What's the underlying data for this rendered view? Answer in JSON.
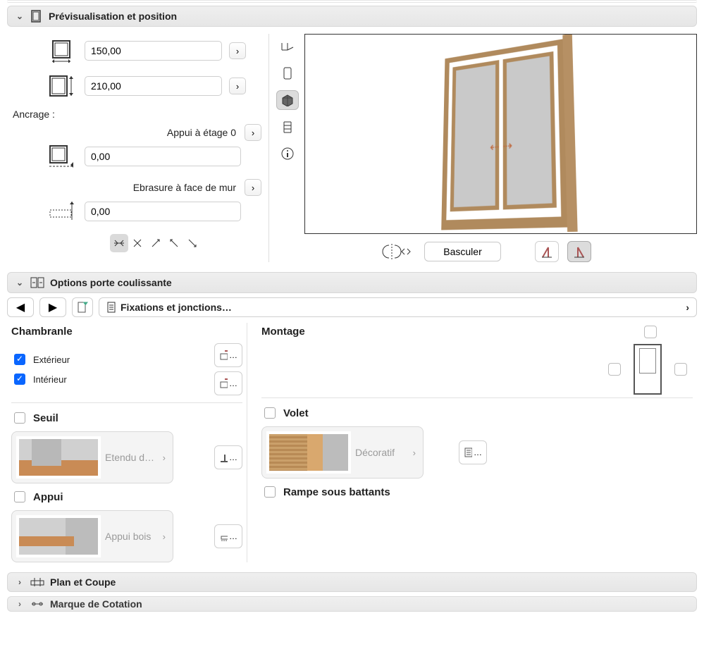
{
  "sections": {
    "preview": {
      "title": "Prévisualisation et position"
    },
    "options": {
      "title": "Options porte coulissante"
    },
    "plan": {
      "title": "Plan et Coupe"
    },
    "quote": {
      "title": "Marque de Cotation"
    }
  },
  "dims": {
    "width": "150,00",
    "height": "210,00"
  },
  "anchor": {
    "label": "Ancrage :",
    "story": {
      "label": "Appui à étage 0",
      "value": "0,00"
    },
    "reveal": {
      "label": "Ebrasure à face de mur",
      "value": "0,00"
    }
  },
  "preview_actions": {
    "flip_label": "Basculer"
  },
  "breadcrumb": {
    "label": "Fixations et jonctions…"
  },
  "chambranle": {
    "title": "Chambranle",
    "ext": {
      "label": "Extérieur",
      "checked": true
    },
    "int": {
      "label": "Intérieur",
      "checked": true
    }
  },
  "montage": {
    "title": "Montage"
  },
  "seuil": {
    "title": "Seuil",
    "card_label": "Etendu d…",
    "checked": false
  },
  "volet": {
    "title": "Volet",
    "card_label": "Décoratif",
    "checked": false
  },
  "appui": {
    "title": "Appui",
    "card_label": "Appui bois",
    "checked": false
  },
  "rampe": {
    "title": "Rampe sous battants",
    "checked": false
  }
}
